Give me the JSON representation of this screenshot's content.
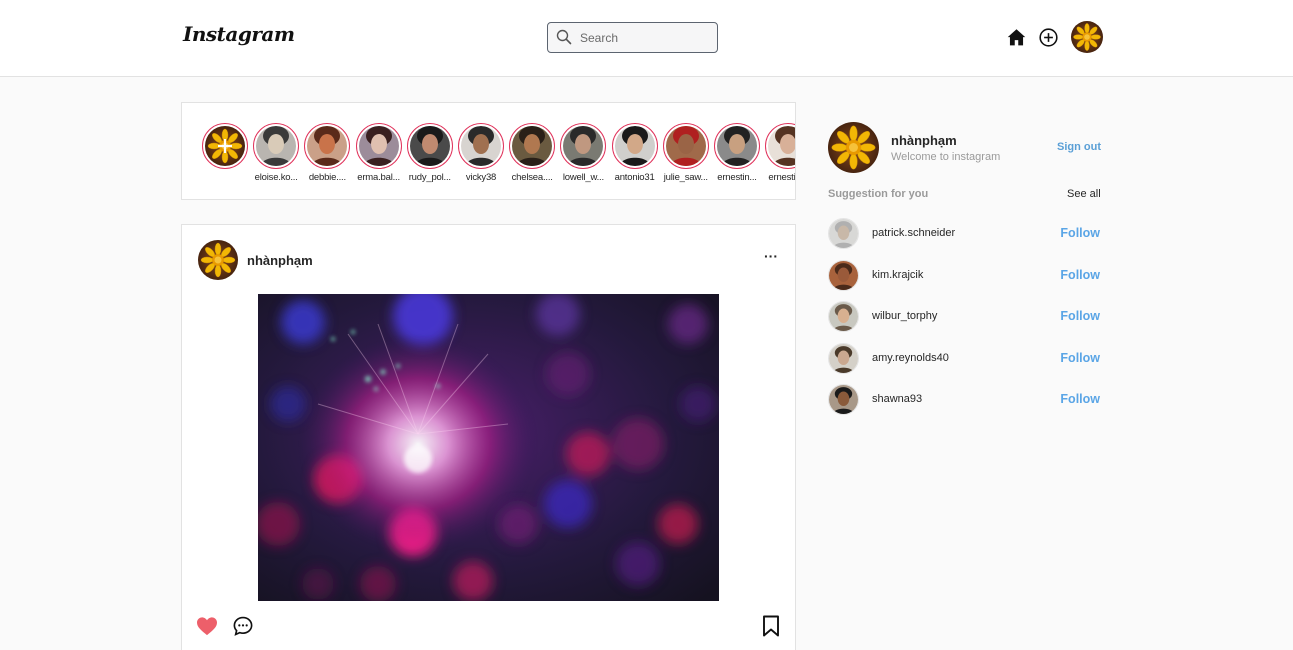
{
  "header": {
    "logo": "Instagram",
    "search": {
      "placeholder": "Search",
      "value": ""
    },
    "icons": [
      "home-icon",
      "add-post-icon",
      "profile-avatar"
    ]
  },
  "stories": [
    {
      "name": "",
      "avatar": "add-story-flower"
    },
    {
      "name": "eloise.ko...",
      "avatar": "person"
    },
    {
      "name": "debbie....",
      "avatar": "person"
    },
    {
      "name": "erma.bal...",
      "avatar": "person"
    },
    {
      "name": "rudy_pol...",
      "avatar": "person"
    },
    {
      "name": "vicky38",
      "avatar": "person"
    },
    {
      "name": "chelsea....",
      "avatar": "person"
    },
    {
      "name": "lowell_w...",
      "avatar": "person"
    },
    {
      "name": "antonio31",
      "avatar": "person"
    },
    {
      "name": "julie_saw...",
      "avatar": "person"
    },
    {
      "name": "ernestin...",
      "avatar": "person"
    },
    {
      "name": "ernestin...",
      "avatar": "person"
    }
  ],
  "post": {
    "username": "nhànphạm",
    "more": "···",
    "image": "bokeh-light-photo",
    "actions": {
      "liked": true
    }
  },
  "sidebar": {
    "username": "nhànphạm",
    "welcome": "Welcome to instagram",
    "sign_out": "Sign out",
    "suggestion_title": "Suggestion for you",
    "see_all": "See all",
    "suggestions": [
      {
        "username": "patrick.schneider",
        "follow": "Follow"
      },
      {
        "username": "kim.krajcik",
        "follow": "Follow"
      },
      {
        "username": "wilbur_torphy",
        "follow": "Follow"
      },
      {
        "username": "amy.reynolds40",
        "follow": "Follow"
      },
      {
        "username": "shawna93",
        "follow": "Follow"
      }
    ]
  },
  "colors": {
    "accent": "#5aa5e6",
    "story_ring": "#e0335b",
    "like": "#ed4956",
    "background": "#fafafa"
  }
}
